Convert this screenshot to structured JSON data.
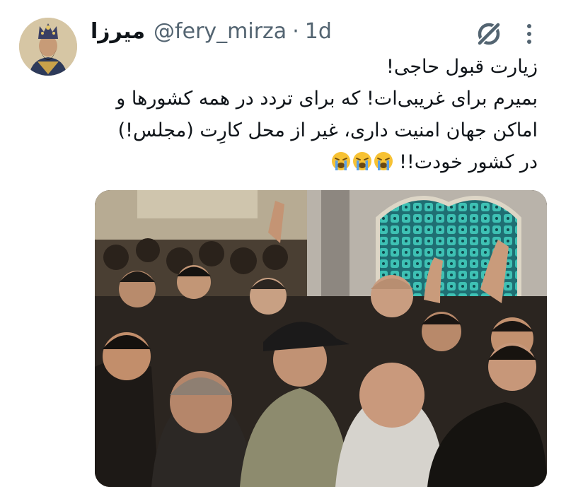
{
  "tweet": {
    "author_name": "میرزا",
    "handle": "@fery_mirza",
    "separator": "·",
    "time": "1d",
    "lines": [
      "زیارت قبول حاجی!",
      "بمیرم برای غریبی‌ات! که برای تردد در همه کشورها و",
      "اماکن جهان امنیت داری، غیر از محل کارِت (مجلس!)",
      "در کشور خودت!!"
    ],
    "line4_emojis": [
      "crying-face",
      "crying-face",
      "crying-face"
    ]
  },
  "icons": {
    "grok": "grok-icon",
    "more": "more-vertical-icon"
  },
  "colors": {
    "text": "#0f1419",
    "secondary": "#536471",
    "emoji_yellow": "#f7c234",
    "tear_blue": "#5aa0e8",
    "glass_teal": "#2fa69a"
  }
}
